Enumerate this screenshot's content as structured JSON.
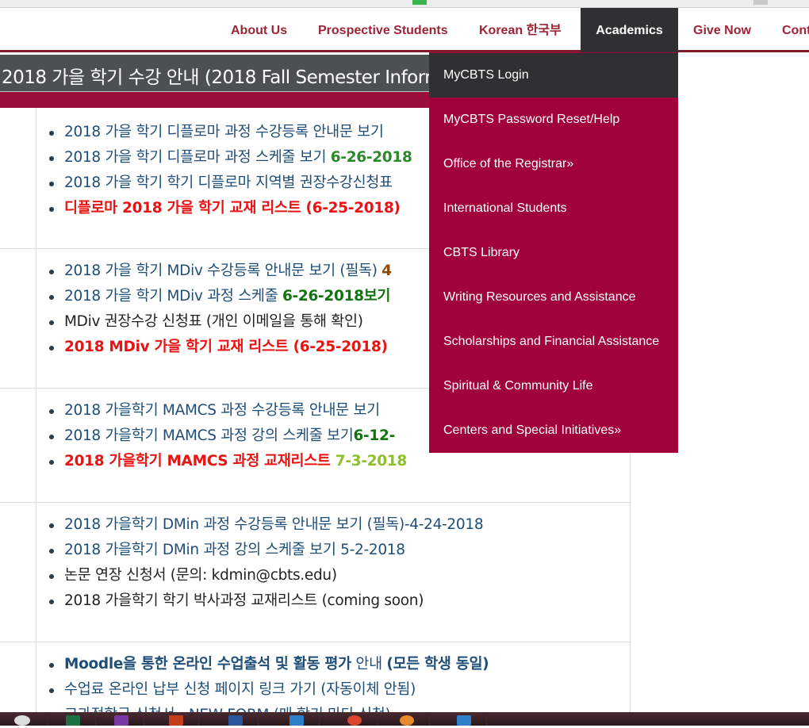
{
  "nav": {
    "items": [
      "About Us",
      "Prospective Students",
      "Korean 한국부",
      "Academics",
      "Give Now",
      "Cont"
    ],
    "active_index": 3
  },
  "page_title": "2018  가을 학기 수강 안내 (2018 Fall Semester Inform",
  "dropdown": {
    "items": [
      "MyCBTS Login",
      "MyCBTS Password Reset/Help",
      "Office of the Registrar»",
      "International Students",
      "CBTS Library",
      "Writing Resources and Assistance",
      "Scholarships and Financial Assistance",
      "Spiritual & Community Life",
      "Centers and Special Initiatives»"
    ]
  },
  "sections": [
    {
      "items": [
        [
          {
            "t": "2018 가을 학기 디플로마 과정 수강등록 안내문 보기",
            "c": "blue"
          }
        ],
        [
          {
            "t": "2018 가을 학기 디플로마 과정 스케줄 보기 ",
            "c": "blue"
          },
          {
            "t": "6-26-2018",
            "c": "green"
          }
        ],
        [
          {
            "t": "2018 가을 학기 학기 디플로마 지역별 권장수강신청표",
            "c": "blue"
          }
        ],
        [
          {
            "t": "디플로마 2018 가을 학기 교재 리스트 (6-25-2018)",
            "c": "red"
          }
        ]
      ]
    },
    {
      "items": [
        [
          {
            "t": "2018 가을 학기 MDiv 수강등록 안내문 보기 (필독) ",
            "c": "blue"
          },
          {
            "t": "4",
            "c": "brown"
          }
        ],
        [
          {
            "t": "2018 가을 학기 MDiv 과정 스케줄 ",
            "c": "blue"
          },
          {
            "t": "6-26-2018보기",
            "c": "dgreen"
          }
        ],
        [
          {
            "t": "MDiv 권장수강 신청표 (개인 이메일을 통해 확인)",
            "c": "dark"
          }
        ],
        [
          {
            "t": "2018  MDiv 가을 학기 교재 리스트 (6-25-2018)",
            "c": "red"
          }
        ]
      ]
    },
    {
      "items": [
        [
          {
            "t": "2018 가을학기 MAMCS 과정 수강등록 안내문 보기",
            "c": "blue"
          }
        ],
        [
          {
            "t": "2018 가을학기 MAMCS 과정 강의 스케줄 보기",
            "c": "blue"
          },
          {
            "t": "6-12-",
            "c": "dgreen"
          }
        ],
        [
          {
            "t": "2018 가을학기 MAMCS 과정 교재리스트 ",
            "c": "red"
          },
          {
            "t": "7-3-2018",
            "c": "lgreen"
          }
        ]
      ]
    },
    {
      "items": [
        [
          {
            "t": "2018 가을학기 DMin 과정 수강등록 안내문 보기 (필독)-4-24-2018",
            "c": "blue"
          }
        ],
        [
          {
            "t": "2018 가을학기 DMin 과정 강의 스케줄 보기 5-2-2018",
            "c": "blue"
          }
        ],
        [
          {
            "t": "논문 연장 신청서 (문의: kdmin@cbts.edu)",
            "c": "dark"
          }
        ],
        [
          {
            "t": "2018  가을학기 학기 박사과정 교재리스트 (coming soon)",
            "c": "dark"
          }
        ]
      ]
    },
    {
      "items": [
        [
          {
            "t": "Moodle을 통한 온라인 수업출석 및 활동 평가",
            "c": "navy"
          },
          {
            "t": " 안내 ",
            "c": "blue"
          },
          {
            "t": "(모든 학생 동일)",
            "c": "navy"
          }
        ],
        [
          {
            "t": "수업료  온라인 납부 신청 페이지 링크 가기  (자동이체 안됨)",
            "c": "blue"
          }
        ],
        [
          {
            "t": "교과정학금 신청서 - NEW FORM (매 학기 마다 신청)",
            "c": "blue"
          }
        ]
      ]
    }
  ],
  "taskbar": {
    "icons": [
      "windows-icon",
      "excel-icon",
      "onenote-icon",
      "powerpoint-icon",
      "word-icon",
      "outlook-icon",
      "chrome-icon",
      "firefox-icon",
      "outlook-icon"
    ]
  }
}
